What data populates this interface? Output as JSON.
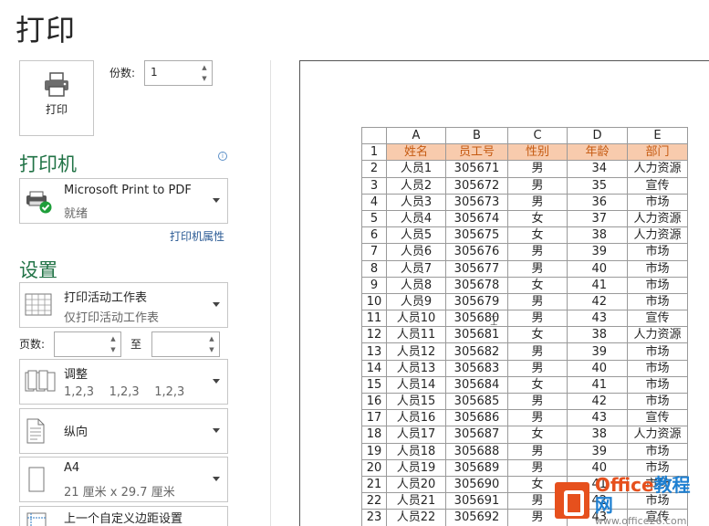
{
  "page": {
    "title": "打印"
  },
  "print_button": {
    "label": "打印",
    "icon": "printer-icon"
  },
  "copies": {
    "label": "份数:",
    "value": "1"
  },
  "printer": {
    "heading": "打印机",
    "name": "Microsoft Print to PDF",
    "status": "就绪",
    "properties_link": "打印机属性",
    "info_icon": "info-icon"
  },
  "settings": {
    "heading": "设置",
    "scope": {
      "title": "打印活动工作表",
      "subtitle": "仅打印活动工作表"
    },
    "pages": {
      "label": "页数:",
      "to_label": "至",
      "from_value": "",
      "to_value": ""
    },
    "collate": {
      "title": "调整",
      "subtitle": "1,2,3    1,2,3    1,2,3"
    },
    "orientation": {
      "title": "纵向"
    },
    "paper": {
      "title": "A4",
      "subtitle": "21 厘米 x 29.7 厘米"
    },
    "margins": {
      "title": "上一个自定义边距设置"
    }
  },
  "sheet": {
    "columns": [
      "A",
      "B",
      "C",
      "D",
      "E"
    ],
    "header": [
      "姓名",
      "员工号",
      "性别",
      "年龄",
      "部门"
    ],
    "rows": [
      [
        "人员1",
        "305671",
        "男",
        "34",
        "人力资源"
      ],
      [
        "人员2",
        "305672",
        "男",
        "35",
        "宣传"
      ],
      [
        "人员3",
        "305673",
        "男",
        "36",
        "市场"
      ],
      [
        "人员4",
        "305674",
        "女",
        "37",
        "人力资源"
      ],
      [
        "人员5",
        "305675",
        "女",
        "38",
        "人力资源"
      ],
      [
        "人员6",
        "305676",
        "男",
        "39",
        "市场"
      ],
      [
        "人员7",
        "305677",
        "男",
        "40",
        "市场"
      ],
      [
        "人员8",
        "305678",
        "女",
        "41",
        "市场"
      ],
      [
        "人员9",
        "305679",
        "男",
        "42",
        "市场"
      ],
      [
        "人员10",
        "305680",
        "男",
        "43",
        "宣传"
      ],
      [
        "人员11",
        "305681",
        "女",
        "38",
        "人力资源"
      ],
      [
        "人员12",
        "305682",
        "男",
        "39",
        "市场"
      ],
      [
        "人员13",
        "305683",
        "男",
        "40",
        "市场"
      ],
      [
        "人员14",
        "305684",
        "女",
        "41",
        "市场"
      ],
      [
        "人员15",
        "305685",
        "男",
        "42",
        "市场"
      ],
      [
        "人员16",
        "305686",
        "男",
        "43",
        "宣传"
      ],
      [
        "人员17",
        "305687",
        "女",
        "38",
        "人力资源"
      ],
      [
        "人员18",
        "305688",
        "男",
        "39",
        "市场"
      ],
      [
        "人员19",
        "305689",
        "男",
        "40",
        "市场"
      ],
      [
        "人员20",
        "305690",
        "女",
        "41",
        "市场"
      ],
      [
        "人员21",
        "305691",
        "男",
        "42",
        "市场"
      ],
      [
        "人员22",
        "305692",
        "男",
        "43",
        "宣传"
      ]
    ]
  },
  "watermark": {
    "brand_a": "Office",
    "brand_b": "教程网",
    "url": "www.office26.com"
  },
  "colors": {
    "accent": "#217346",
    "header_fill": "#f8cbad",
    "header_text": "#c55a11",
    "link": "#2a5a94"
  }
}
